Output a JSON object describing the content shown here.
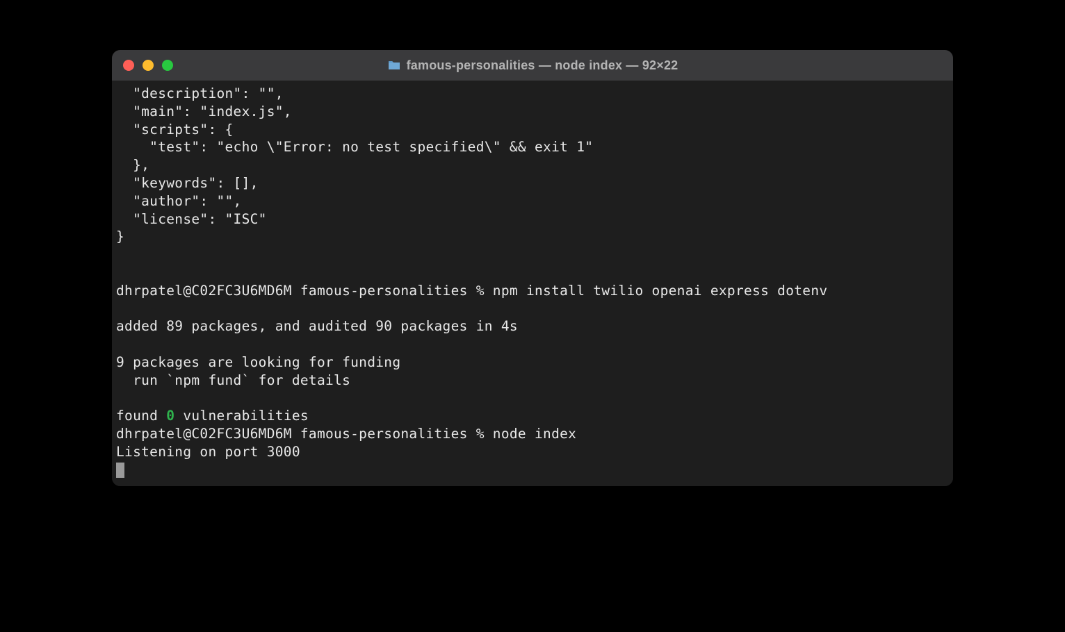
{
  "window": {
    "title": "famous-personalities — node index — 92×22"
  },
  "terminal": {
    "lines": [
      "  \"description\": \"\",",
      "  \"main\": \"index.js\",",
      "  \"scripts\": {",
      "    \"test\": \"echo \\\"Error: no test specified\\\" && exit 1\"",
      "  },",
      "  \"keywords\": [],",
      "  \"author\": \"\",",
      "  \"license\": \"ISC\"",
      "}",
      "",
      "",
      "dhrpatel@C02FC3U6MD6M famous-personalities % npm install twilio openai express dotenv",
      "",
      "added 89 packages, and audited 90 packages in 4s",
      "",
      "9 packages are looking for funding",
      "  run `npm fund` for details",
      ""
    ],
    "found_prefix": "found ",
    "found_count": "0",
    "found_suffix": " vulnerabilities",
    "prompt2": "dhrpatel@C02FC3U6MD6M famous-personalities % node index",
    "listening": "Listening on port 3000"
  }
}
